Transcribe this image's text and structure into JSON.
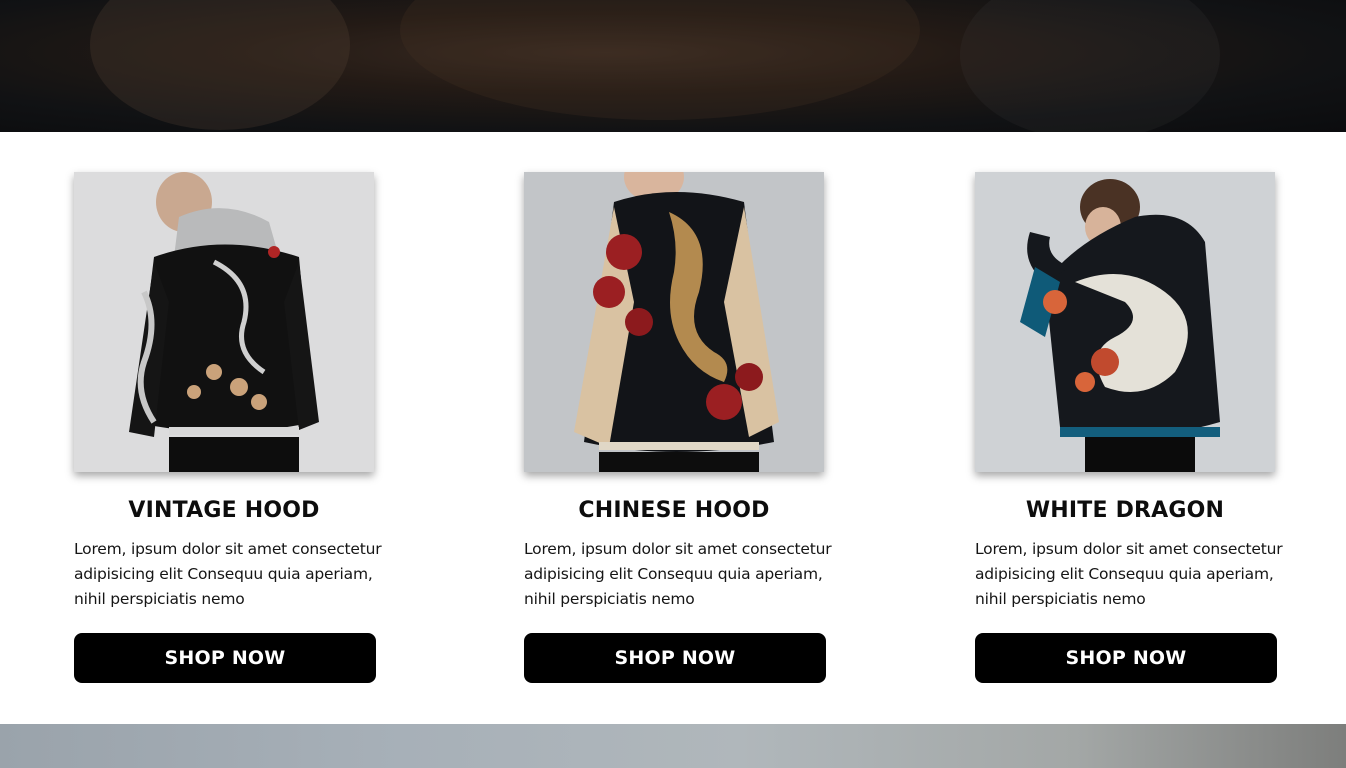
{
  "products": [
    {
      "title": "VINTAGE HOOD",
      "description": "Lorem, ipsum dolor sit amet consectetur adipisicing elit Consequu quia aperiam, nihil perspiciatis nemo",
      "button_label": "SHOP NOW",
      "image_icon": "vintage-hood-jacket-photo"
    },
    {
      "title": "CHINESE HOOD",
      "description": "Lorem, ipsum dolor sit amet consectetur adipisicing elit Consequu quia aperiam, nihil perspiciatis nemo",
      "button_label": "SHOP NOW",
      "image_icon": "chinese-hood-jacket-photo"
    },
    {
      "title": "WHITE DRAGON",
      "description": "Lorem, ipsum dolor sit amet consectetur adipisicing elit Consequu quia aperiam, nihil perspiciatis nemo",
      "button_label": "SHOP NOW",
      "image_icon": "white-dragon-jacket-photo"
    }
  ],
  "colors": {
    "button_bg": "#000000",
    "button_text": "#ffffff",
    "page_bg": "#ffffff"
  }
}
